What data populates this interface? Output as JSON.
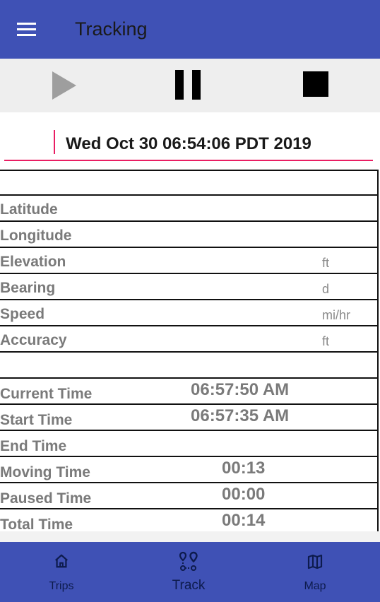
{
  "appbar": {
    "title": "Tracking",
    "menu_icon": "hamburger-menu-icon"
  },
  "controls": {
    "play_icon": "play-icon",
    "pause_icon": "pause-icon",
    "stop_icon": "stop-icon"
  },
  "date_field": {
    "value": "Wed Oct 30 06:54:06 PDT 2019"
  },
  "location_rows": [
    {
      "label": "",
      "unit": ""
    },
    {
      "label": "Latitude",
      "unit": ""
    },
    {
      "label": "Longitude",
      "unit": ""
    },
    {
      "label": "Elevation",
      "unit": "ft"
    },
    {
      "label": "Bearing",
      "unit": "d"
    },
    {
      "label": "Speed",
      "unit": "mi/hr"
    },
    {
      "label": "Accuracy",
      "unit": "ft"
    },
    {
      "label": "",
      "unit": ""
    }
  ],
  "time_rows": [
    {
      "label": "Current Time",
      "value": "06:57:50 AM"
    },
    {
      "label": "Start Time",
      "value": "06:57:35 AM"
    },
    {
      "label": "End Time",
      "value": ""
    },
    {
      "label": "Moving Time",
      "value": "00:13"
    },
    {
      "label": "Paused Time",
      "value": "00:00"
    },
    {
      "label": "Total Time",
      "value": "00:14"
    }
  ],
  "bottom_nav": {
    "items": [
      {
        "label": "Trips",
        "icon": "home-icon",
        "active": false
      },
      {
        "label": "Track",
        "icon": "route-icon",
        "active": true
      },
      {
        "label": "Map",
        "icon": "map-icon",
        "active": false
      }
    ]
  },
  "colors": {
    "primary": "#3f51b5",
    "accent": "#e91e63"
  }
}
